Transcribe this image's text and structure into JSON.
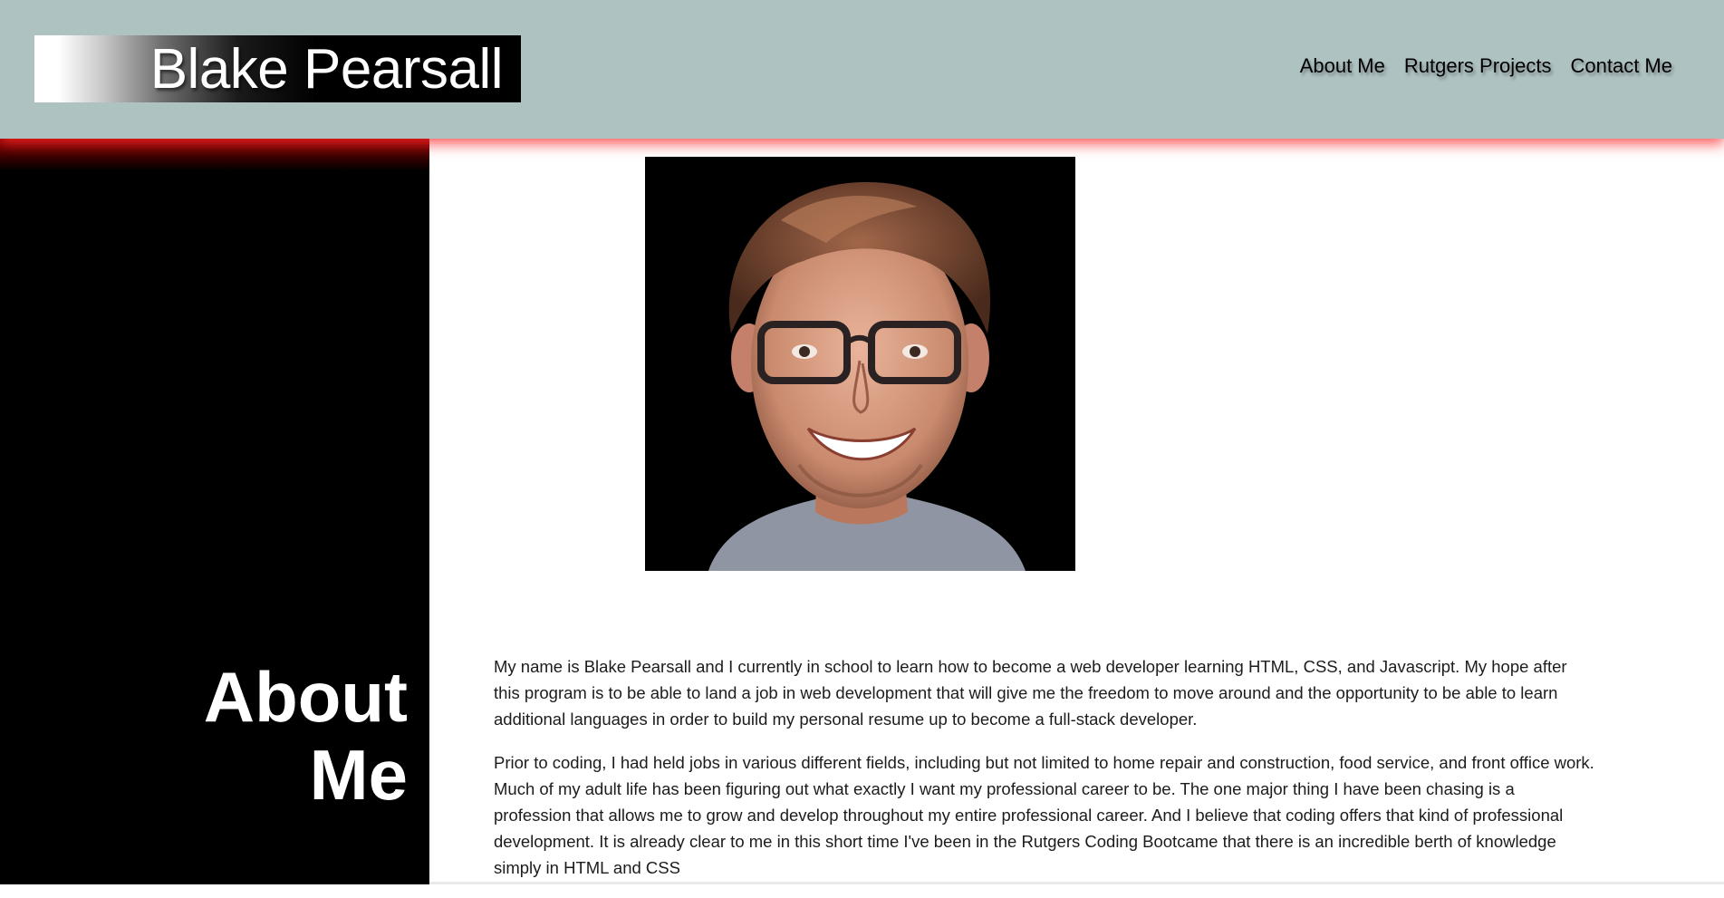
{
  "header": {
    "logo_text": "Blake Pearsall",
    "nav": [
      {
        "label": "About Me"
      },
      {
        "label": "Rutgers Projects"
      },
      {
        "label": "Contact Me"
      }
    ]
  },
  "sidebar": {
    "title_line1": "About",
    "title_line2": "Me"
  },
  "main": {
    "paragraphs": [
      "My name is Blake Pearsall and I currently in school to learn how to become a web developer learning HTML, CSS, and Javascript. My hope after this program is to be able to land a job in web development that will give me the freedom to move around and the opportunity to be able to learn additional languages in order to build my personal resume up to become a full-stack developer.",
      "Prior to coding, I had held jobs in various different fields, including but not limited to home repair and construction, food service, and front office work. Much of my adult life has been figuring out what exactly I want my professional career to be. The one major thing I have been chasing is a profession that allows me to grow and develop throughout my entire professional career. And I believe that coding offers that kind of professional development. It is already clear to me in this short time I've been in the Rutgers Coding Bootcame that there is an incredible berth of knowledge simply in HTML and CSS"
    ]
  },
  "colors": {
    "header_bg": "#afc2c2",
    "sidebar_bg": "#000000",
    "accent_glow": "#ff2828"
  }
}
